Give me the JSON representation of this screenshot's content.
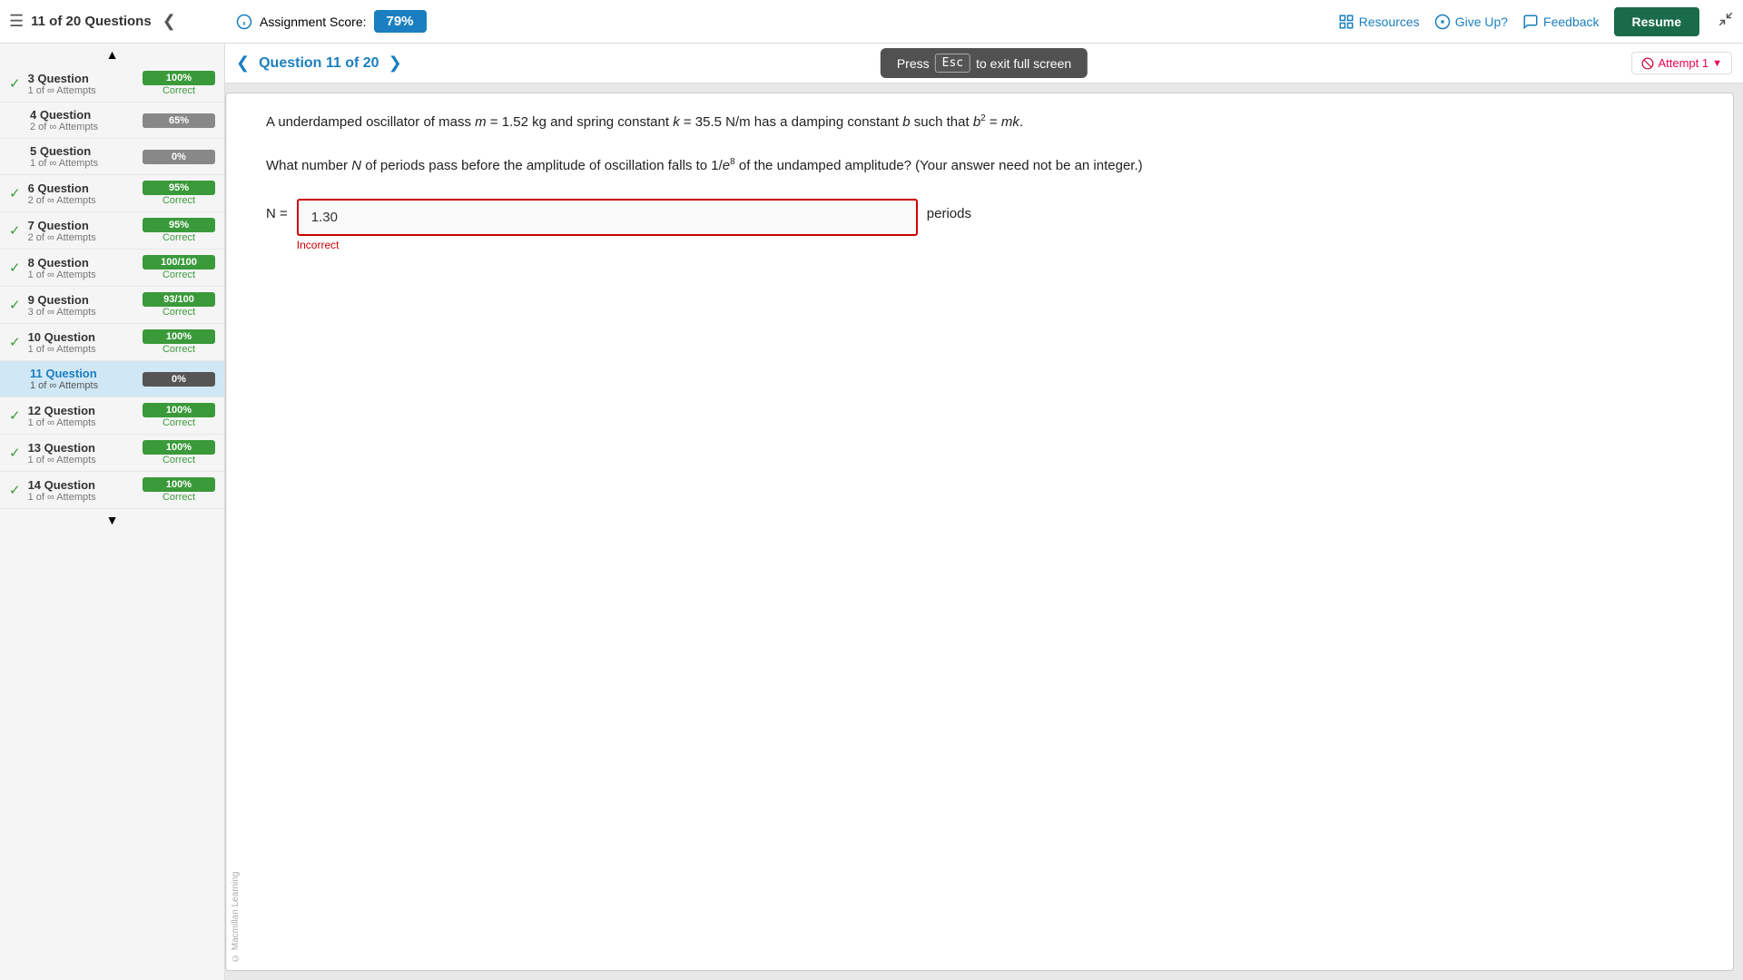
{
  "header": {
    "title": "11 of 20 Questions",
    "assignment_score_label": "Assignment Score:",
    "score": "79%",
    "resources_label": "Resources",
    "give_up_label": "Give Up?",
    "feedback_label": "Feedback",
    "resume_label": "Resume"
  },
  "esc_banner": {
    "press": "Press",
    "key": "Esc",
    "to_exit": "to exit full screen"
  },
  "question_nav": {
    "title": "Question 11 of 20",
    "attempt_label": "Attempt 1"
  },
  "question": {
    "text_part1": "A underdamped oscillator of mass m = 1.52 kg and spring constant k = 35.5 N/m has a damping constant b such that b",
    "text_sup": "2",
    "text_part2": " = mk.",
    "text_part3": "What number N of periods pass before the amplitude of oscillation falls to 1/e",
    "text_sup2": "8",
    "text_part4": " of the undamped amplitude? (Your answer need not be an integer.)",
    "n_label": "N =",
    "answer_value": "1.30",
    "incorrect_label": "Incorrect",
    "periods_label": "periods"
  },
  "publisher_watermark": "© Macmillan Learning",
  "sidebar": {
    "items": [
      {
        "number": "3",
        "label": "3 Question",
        "attempts": "1 of ∞ Attempts",
        "score": "100%",
        "score_type": "green",
        "status": "Correct",
        "has_check": true
      },
      {
        "number": "4",
        "label": "4 Question",
        "attempts": "2 of ∞ Attempts",
        "score": "65%",
        "score_type": "gray",
        "status": "",
        "has_check": false
      },
      {
        "number": "5",
        "label": "5 Question",
        "attempts": "1 of ∞ Attempts",
        "score": "0%",
        "score_type": "gray",
        "status": "",
        "has_check": false
      },
      {
        "number": "6",
        "label": "6 Question",
        "attempts": "2 of ∞ Attempts",
        "score": "95%",
        "score_type": "green",
        "status": "Correct",
        "has_check": true
      },
      {
        "number": "7",
        "label": "7 Question",
        "attempts": "2 of ∞ Attempts",
        "score": "95%",
        "score_type": "green",
        "status": "Correct",
        "has_check": true
      },
      {
        "number": "8",
        "label": "8 Question",
        "attempts": "1 of ∞ Attempts",
        "score": "100/100",
        "score_type": "green",
        "status": "Correct",
        "has_check": true
      },
      {
        "number": "9",
        "label": "9 Question",
        "attempts": "3 of ∞ Attempts",
        "score": "93/100",
        "score_type": "green",
        "status": "Correct",
        "has_check": true
      },
      {
        "number": "10",
        "label": "10 Question",
        "attempts": "1 of ∞ Attempts",
        "score": "100%",
        "score_type": "green",
        "status": "Correct",
        "has_check": true
      },
      {
        "number": "11",
        "label": "11 Question",
        "attempts": "1 of ∞ Attempts",
        "score": "0%",
        "score_type": "dark-gray",
        "status": "",
        "has_check": false,
        "active": true
      },
      {
        "number": "12",
        "label": "12 Question",
        "attempts": "1 of ∞ Attempts",
        "score": "100%",
        "score_type": "green",
        "status": "Correct",
        "has_check": true
      },
      {
        "number": "13",
        "label": "13 Question",
        "attempts": "1 of ∞ Attempts",
        "score": "100%",
        "score_type": "green",
        "status": "Correct",
        "has_check": true
      },
      {
        "number": "14",
        "label": "14 Question",
        "attempts": "1 of ∞ Attempts",
        "score": "100%",
        "score_type": "green",
        "status": "Correct",
        "has_check": true
      }
    ]
  }
}
